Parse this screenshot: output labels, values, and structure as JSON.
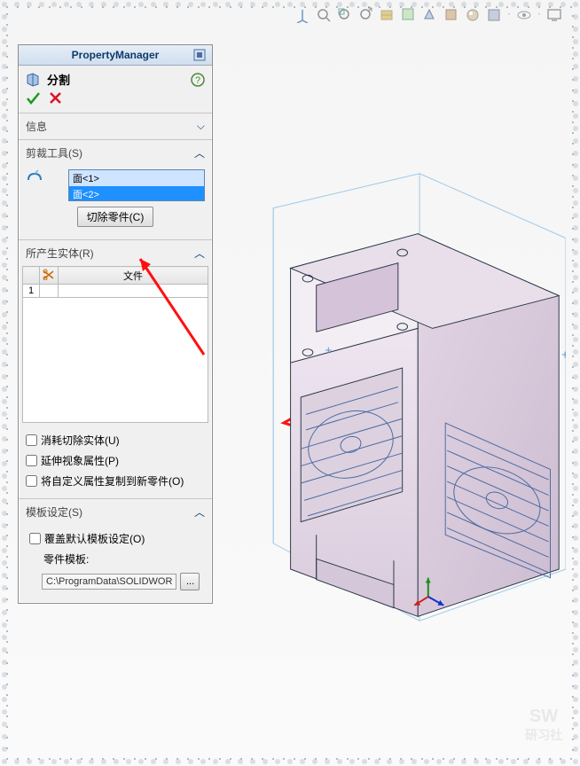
{
  "header": {
    "title": "PropertyManager"
  },
  "feature": {
    "name": "分割"
  },
  "sections": {
    "info": {
      "label": "信息"
    },
    "trimTools": {
      "label": "剪裁工具(S)",
      "items": [
        "面<1>",
        "面<2>"
      ],
      "button": "切除零件(C)"
    },
    "resultBodies": {
      "label": "所产生实体(R)",
      "columnHeader": "文件",
      "rowIndex": "1"
    },
    "options": {
      "consume": "消耗切除实体(U)",
      "extend": "延伸视象属性(P)",
      "copyCustom": "将自定义属性复制到新零件(O)"
    },
    "template": {
      "label": "模板设定(S)",
      "override": "覆盖默认模板设定(O)",
      "partTemplate": "零件模板:",
      "path": "C:\\ProgramData\\SOLIDWORKS\\"
    }
  }
}
